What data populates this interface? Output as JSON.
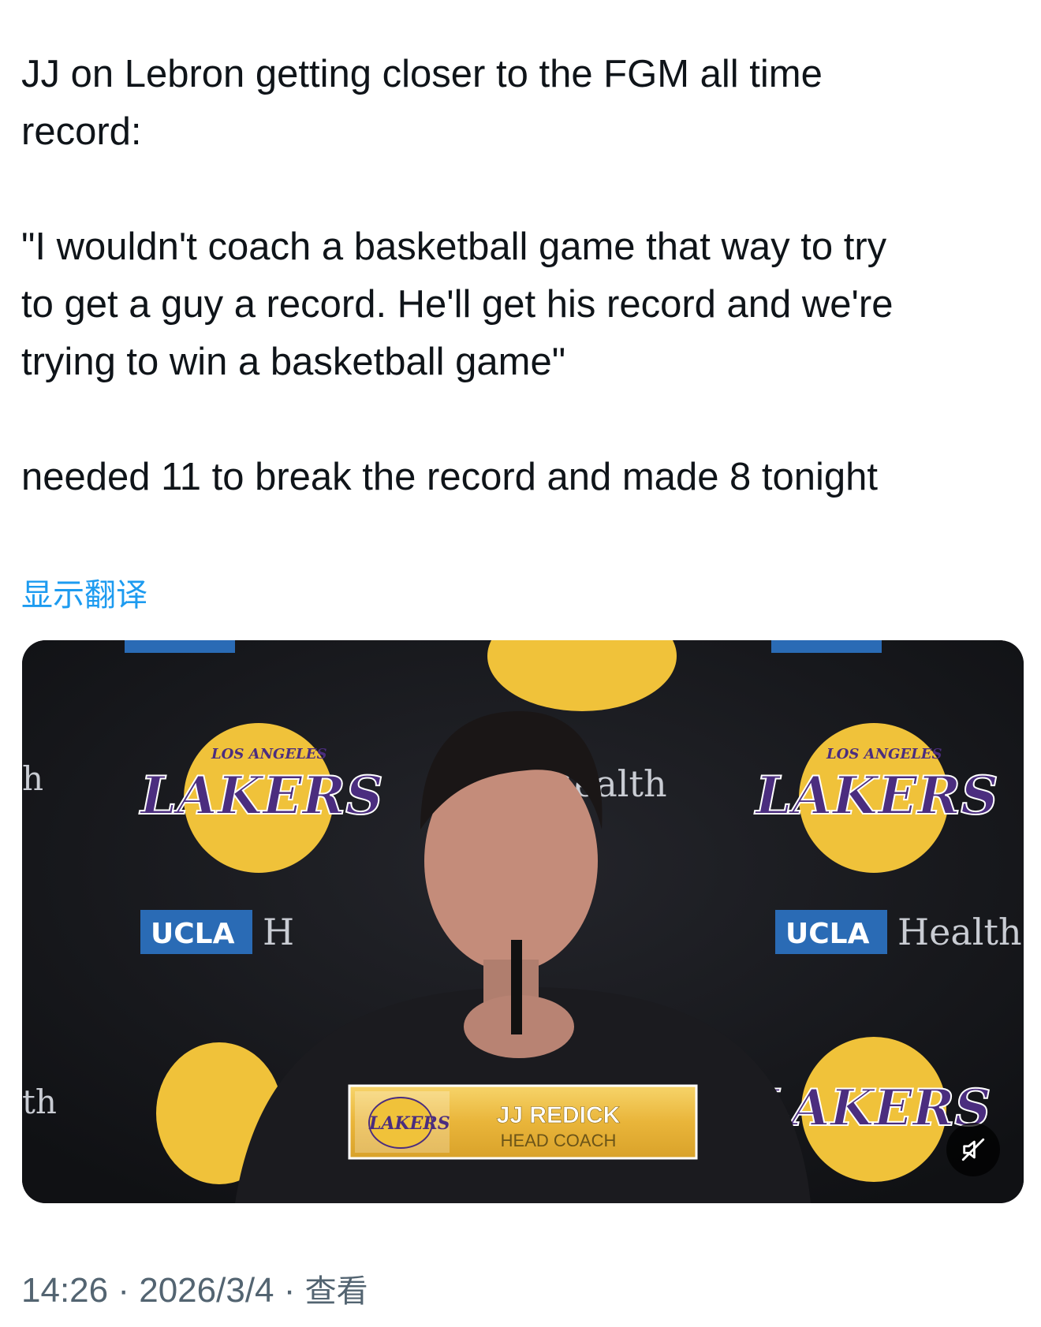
{
  "tweet": {
    "text": "JJ on Lebron getting closer to the FGM all time\nrecord:\n\n\"I wouldn't coach a basketball game that way to try\nto get a guy a record. He'll get his record and we're\ntrying to win a basketball game\"\n\nneeded 11 to break the record and made 8 tonight",
    "translate_label": "显示翻译"
  },
  "video": {
    "backdrop_logo_small": "LOS ANGELES",
    "backdrop_logo_big": "LAKERS",
    "sponsor_ucla": "UCLA",
    "sponsor_health": "Health",
    "lower_third": {
      "logo_text": "LAKERS",
      "name": "JJ REDICK",
      "title": "HEAD COACH"
    },
    "mute_icon": "speaker-muted-icon",
    "colors": {
      "lakers_gold": "#f0c23a",
      "lakers_purple": "#4b2d7f",
      "ucla_blue": "#2a6bb5",
      "backdrop": "#15161a"
    }
  },
  "meta": {
    "time": "14:26",
    "separator": "·",
    "date": "2026/3/4",
    "view_label": "查看"
  },
  "colors": {
    "link": "#1d9bf0",
    "meta_text": "#536471",
    "text": "#0f1419"
  }
}
